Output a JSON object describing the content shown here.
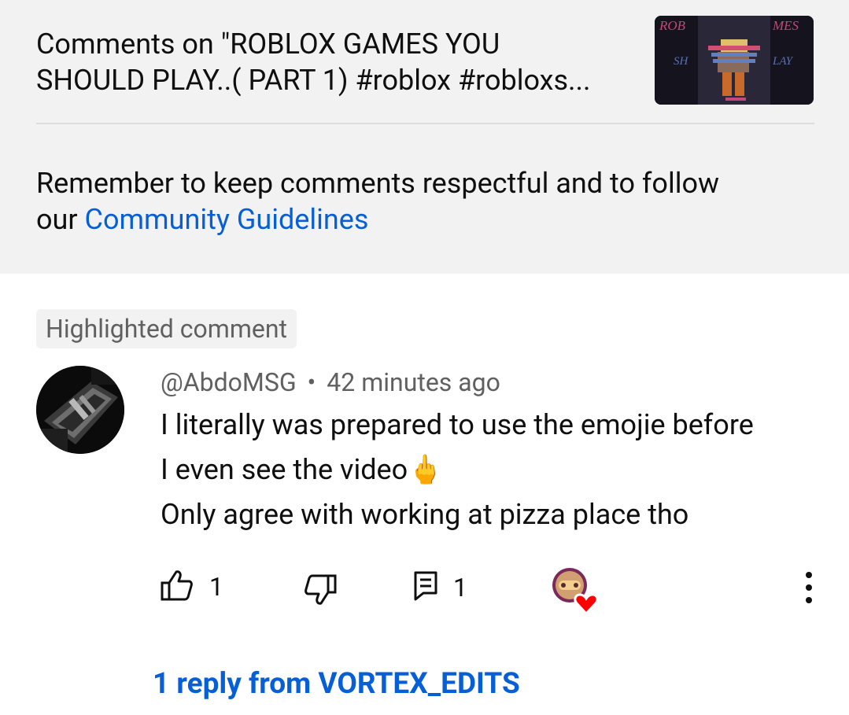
{
  "header": {
    "title_line1": "Comments on \"ROBLOX GAMES YOU",
    "title_line2": "SHOULD PLAY..( PART 1) #roblox #robloxs...",
    "thumbnail_icon": "video-thumbnail"
  },
  "notice": {
    "text_line1": "Remember to keep comments respectful and to follow",
    "text_prefix": "our ",
    "link_text": "Community Guidelines"
  },
  "comment": {
    "chip": "Highlighted comment",
    "author": "@AbdoMSG",
    "separator": "•",
    "time": "42 minutes ago",
    "body_line1": "I literally was prepared to use the emojie before",
    "body_line2": "I even see the video",
    "body_line2_emoji": "🖕",
    "body_line3": "Only agree with working at pizza place tho",
    "like_count": "1",
    "reply_count": "1",
    "like_icon": "thumbs-up-icon",
    "dislike_icon": "thumbs-down-icon",
    "reply_icon": "reply-icon",
    "hearted_icon": "creator-heart-icon",
    "more_icon": "more-vert-icon"
  },
  "replies": {
    "link_text": "1 reply from VORTEX_EDITS"
  },
  "colors": {
    "link_blue": "#065fd4",
    "header_bg": "#f2f2f2",
    "secondary_text": "#606060",
    "heart_red": "#ff0000"
  }
}
